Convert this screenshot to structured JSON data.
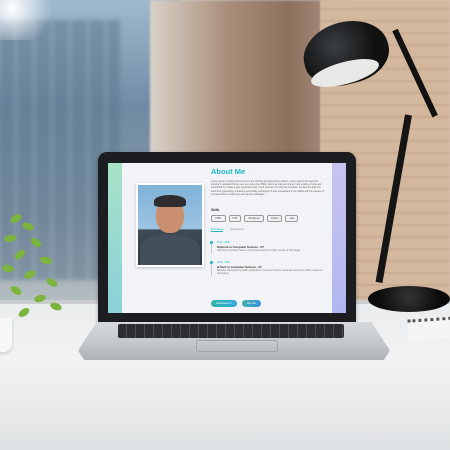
{
  "screen": {
    "title": "About Me",
    "about_text": "Lorem ipsum is simply dummy text of the printing and typesetting industry. Lorem Ipsum has been the industry's standard dummy text ever since the 1500s, when an unknown printer took a galley of type and scrambled it to make a type specimen book. It has survived not only five centuries, but also the leap into electronic typesetting, remaining essentially unchanged. It was popularised in the 1960s with the release of Letraset sheets containing Lorem Ipsum passages.",
    "skills_title": "Skills",
    "skills": [
      "HTML",
      "PHP",
      "Wordpress",
      "Python",
      "Java"
    ],
    "tabs": [
      "Education",
      "Experience"
    ],
    "timeline": [
      {
        "date": "2014 - 2018",
        "title": "Diploma in Computer Science - IIT",
        "desc": "Diploma in Computer Science and Engineering from Indian Institute of Technology."
      },
      {
        "date": "2018 - 2020",
        "title": "B.Tech in Computer Science - IIT",
        "desc": "Bachelor of Engineering under graduation in Computer Science and Engineering from Indian Institute of Technology."
      }
    ],
    "buttons": [
      "Download CV",
      "Hire Me"
    ]
  }
}
